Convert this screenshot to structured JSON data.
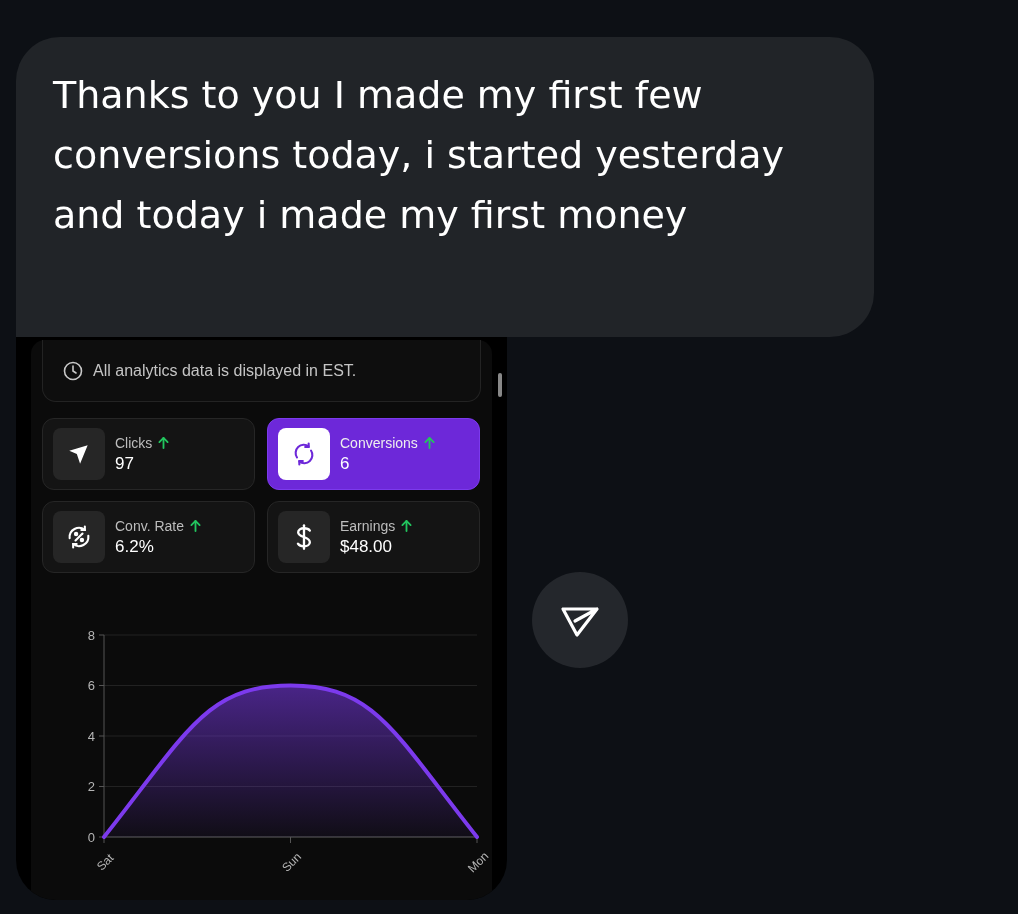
{
  "message": {
    "text": "Thanks to you I made my first few conversions today, i started yesterday and today i made my first money"
  },
  "screenshot": {
    "notice": "All analytics data is displayed in EST.",
    "stats": [
      {
        "label": "Clicks",
        "value": "97",
        "rising": true,
        "selected": false
      },
      {
        "label": "Conversions",
        "value": "6",
        "rising": true,
        "selected": true
      },
      {
        "label": "Conv. Rate",
        "value": "6.2%",
        "rising": true,
        "selected": false
      },
      {
        "label": "Earnings",
        "value": "$48.00",
        "rising": true,
        "selected": false
      }
    ],
    "chart_data": {
      "type": "area",
      "categories": [
        "Sat",
        "Sun",
        "Mon"
      ],
      "series": [
        {
          "color": "#7c3aed",
          "values": [
            0,
            6,
            0
          ]
        }
      ],
      "ylim": [
        0,
        8
      ],
      "yticks": [
        0,
        2,
        4,
        6,
        8
      ],
      "grid": true
    }
  }
}
